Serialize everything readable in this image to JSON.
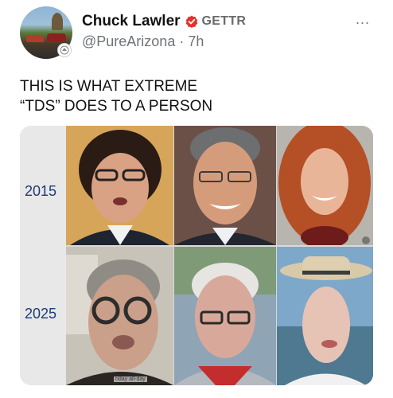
{
  "post": {
    "author_name": "Chuck Lawler",
    "platform": "GETTR",
    "handle": "@PureArizona",
    "separator": "·",
    "time": "7h",
    "more_label": "...",
    "text": "THIS IS WHAT EXTREME\n“TDS” DOES TO A PERSON"
  },
  "media": {
    "year_top": "2015",
    "year_bottom": "2025",
    "caption": "riday all-day"
  },
  "colors": {
    "verified": "#e0352b",
    "text": "#111111",
    "muted": "#6e7378",
    "year_label": "#1d3a7a"
  },
  "icons": [
    "verified-icon",
    "more-icon",
    "avatar-badge-icon"
  ]
}
